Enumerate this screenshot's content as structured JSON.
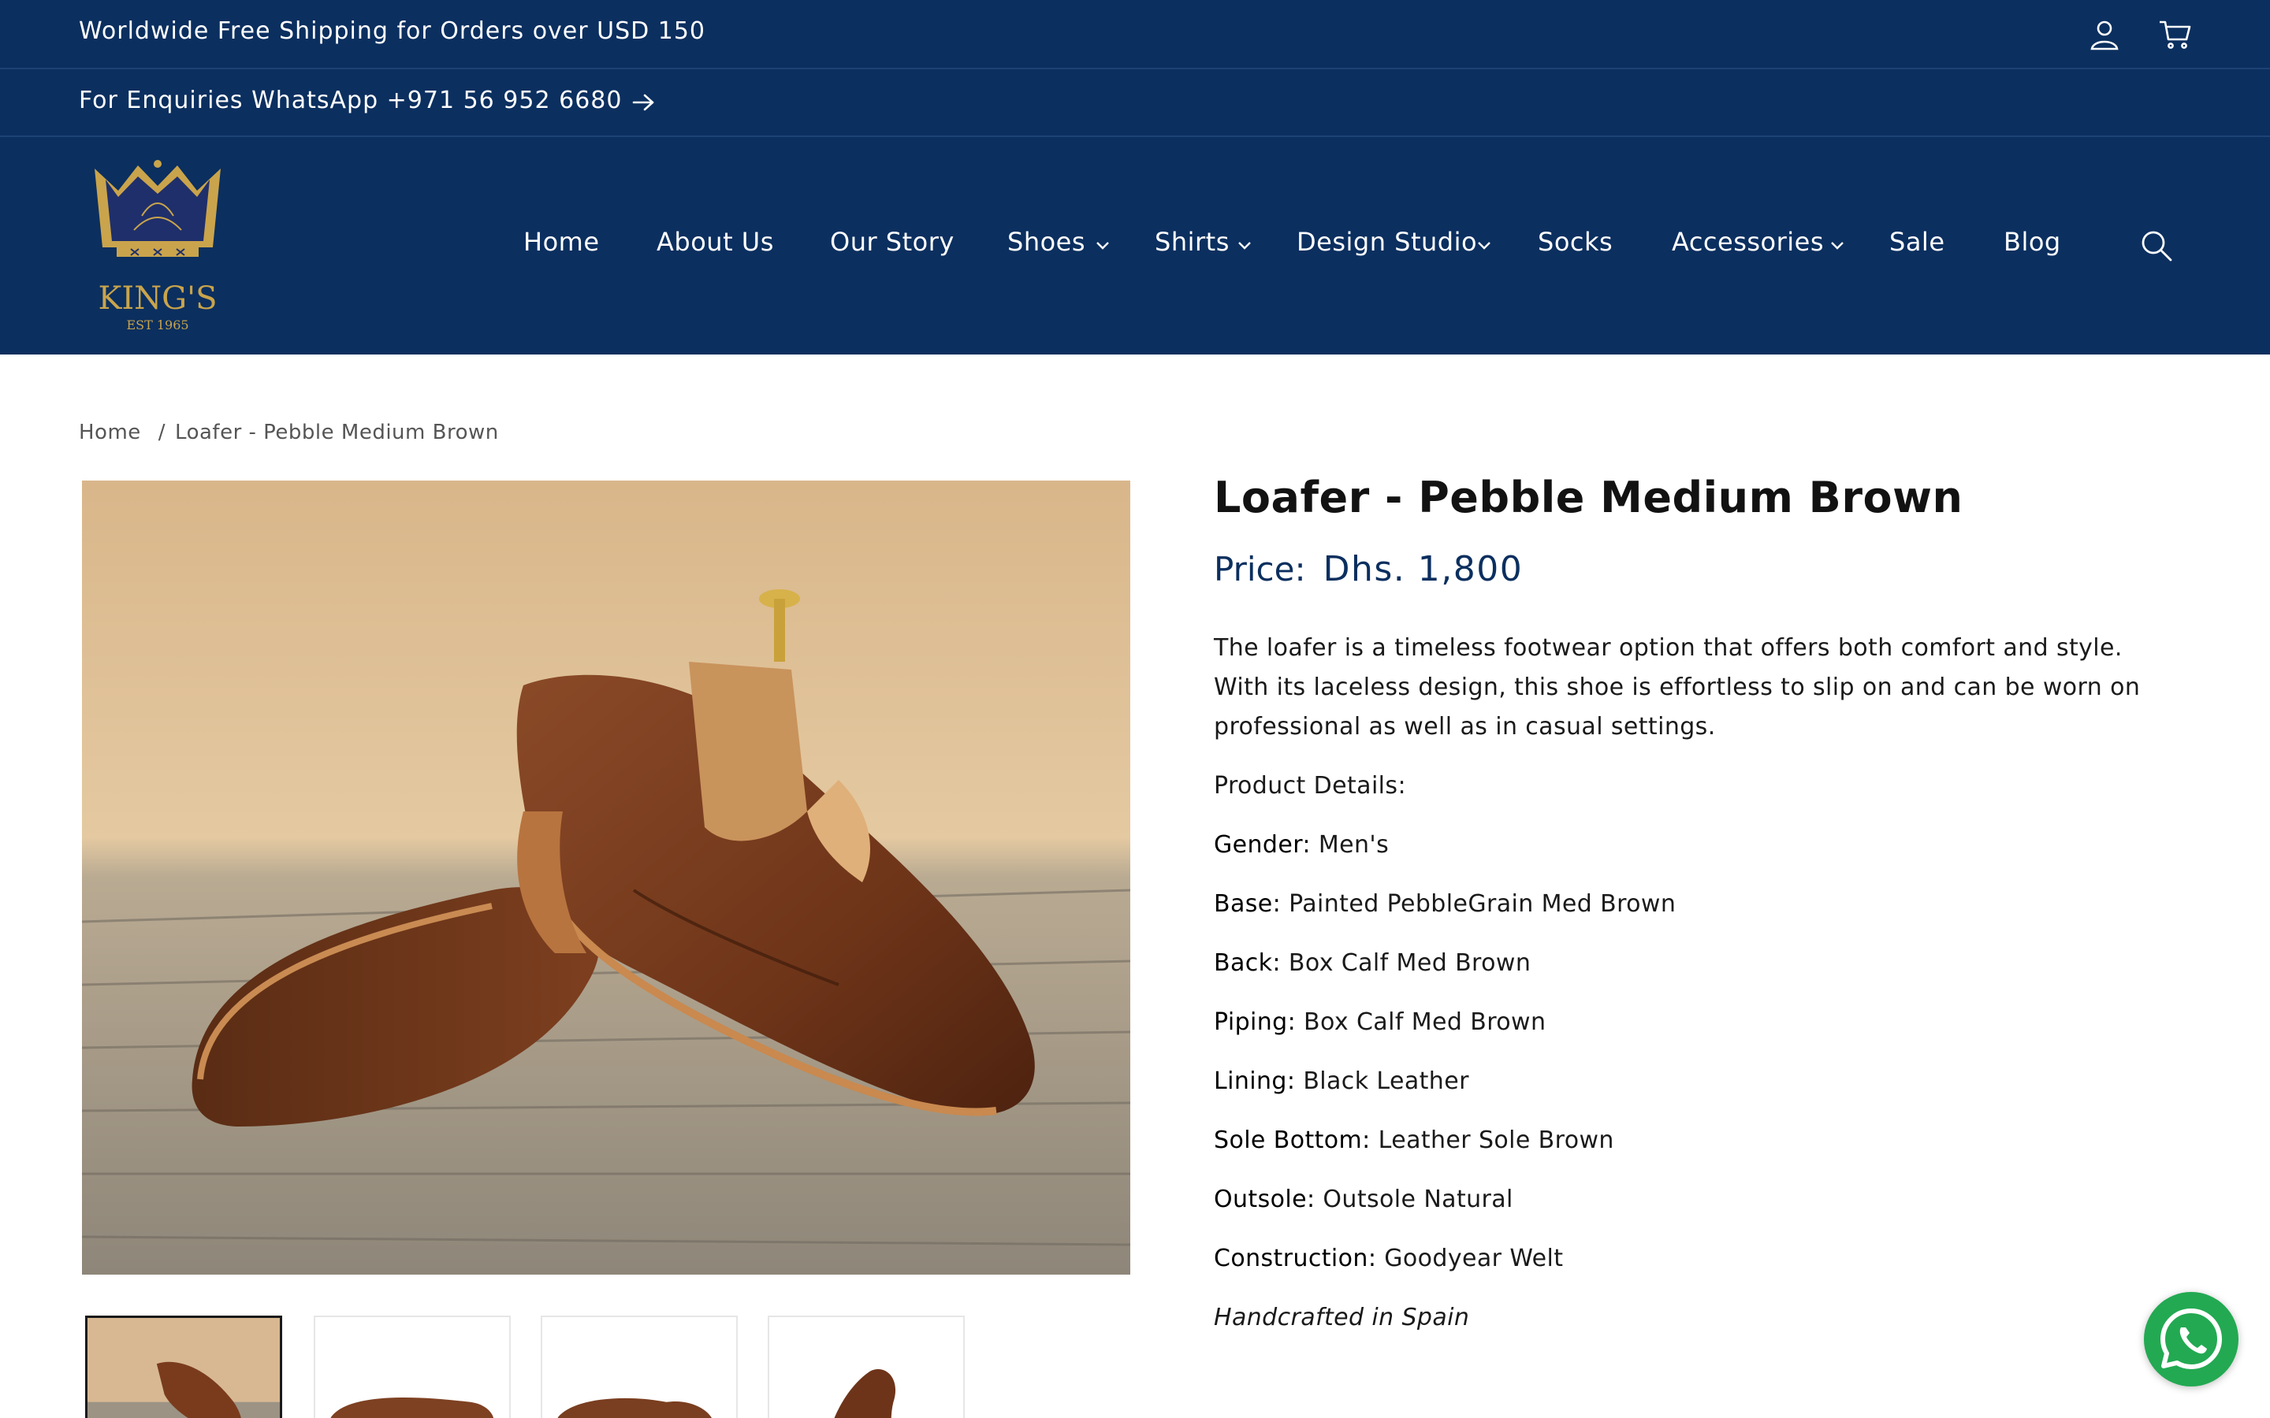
{
  "announcement": {
    "shipping_text": "Worldwide Free Shipping for Orders over USD 150",
    "enquiry_text": "For Enquiries WhatsApp +971 56 952 6680"
  },
  "logo": {
    "brand": "KING'S",
    "established": "EST 1965"
  },
  "nav": {
    "items": [
      {
        "label": "Home"
      },
      {
        "label": "About Us"
      },
      {
        "label": "Our Story"
      },
      {
        "label": "Shoes"
      },
      {
        "label": "Shirts"
      },
      {
        "label": "Design Studio"
      },
      {
        "label": "Socks"
      },
      {
        "label": "Accessories"
      },
      {
        "label": "Sale"
      },
      {
        "label": "Blog"
      }
    ]
  },
  "breadcrumb": {
    "home": "Home",
    "separator": "/",
    "current": "Loafer - Pebble Medium Brown"
  },
  "product": {
    "title": "Loafer - Pebble Medium Brown",
    "price_label": "Price:",
    "price": "Dhs. 1,800",
    "description": "The loafer is a timeless footwear option that offers both comfort and style. With its laceless design, this shoe is effortless to slip on and can be worn on professional as well as in casual settings.",
    "details_heading": "Product Details:",
    "specs": [
      {
        "key": "Gender:",
        "value": "Men's"
      },
      {
        "key": "Base:",
        "value": "Painted PebbleGrain Med Brown"
      },
      {
        "key": "Back:",
        "value": "Box Calf Med Brown"
      },
      {
        "key": "Piping:",
        "value": "Box Calf Med Brown"
      },
      {
        "key": "Lining:",
        "value": "Black Leather"
      },
      {
        "key": "Sole Bottom:",
        "value": "Leather Sole Brown"
      },
      {
        "key": "Outsole:",
        "value": "Outsole Natural"
      },
      {
        "key": "Construction:",
        "value": "Goodyear Welt"
      }
    ],
    "handcrafted": "Handcrafted in Spain"
  },
  "colors": {
    "navy": "#0b2f5f",
    "whatsapp_green": "#23a952",
    "gold": "#c9a44c"
  },
  "icons": {
    "account": "account-icon",
    "cart": "cart-icon",
    "arrow": "arrow-right-icon",
    "search": "search-icon",
    "chevron": "chevron-down-icon",
    "whatsapp": "whatsapp-icon"
  }
}
